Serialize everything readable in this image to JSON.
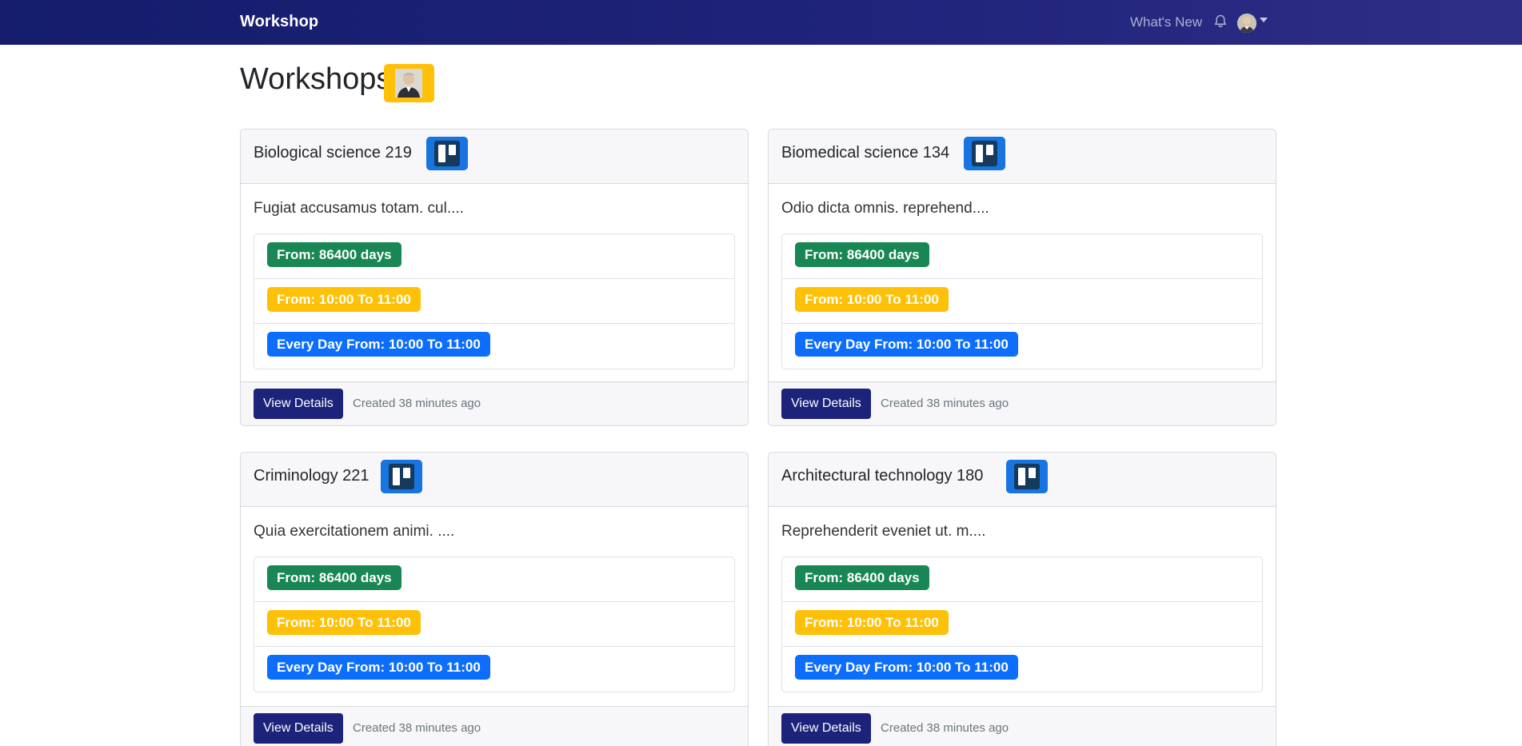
{
  "navbar": {
    "brand": "Workshop",
    "whats_new": "What's New",
    "icons": {
      "bell": "bell-icon",
      "avatar": "user-avatar",
      "caret": "caret-down-icon"
    }
  },
  "page": {
    "title": "Workshops"
  },
  "colors": {
    "navbar": "#141c6b",
    "primary_button": "#1b237a",
    "badge_green": "#198754",
    "badge_yellow": "#ffc107",
    "badge_blue": "#0d6efd",
    "trello_blue": "#1774e0"
  },
  "cards": [
    {
      "title": "Biological science 219",
      "description": "Fugiat accusamus totam. cul....",
      "badges": [
        "From: 86400 days",
        "From: 10:00 To 11:00",
        "Every Day From: 10:00 To 11:00"
      ],
      "button": "View Details",
      "created": "Created 38 minutes ago"
    },
    {
      "title": "Biomedical science 134",
      "description": "Odio dicta omnis. reprehend....",
      "badges": [
        "From: 86400 days",
        "From: 10:00 To 11:00",
        "Every Day From: 10:00 To 11:00"
      ],
      "button": "View Details",
      "created": "Created 38 minutes ago"
    },
    {
      "title": "Criminology 221",
      "description": "Quia exercitationem animi. ....",
      "badges": [
        "From: 86400 days",
        "From: 10:00 To 11:00",
        "Every Day From: 10:00 To 11:00"
      ],
      "button": "View Details",
      "created": "Created 38 minutes ago"
    },
    {
      "title": "Architectural technology 180",
      "description": "Reprehenderit eveniet ut. m....",
      "badges": [
        "From: 86400 days",
        "From: 10:00 To 11:00",
        "Every Day From: 10:00 To 11:00"
      ],
      "button": "View Details",
      "created": "Created 38 minutes ago"
    }
  ]
}
